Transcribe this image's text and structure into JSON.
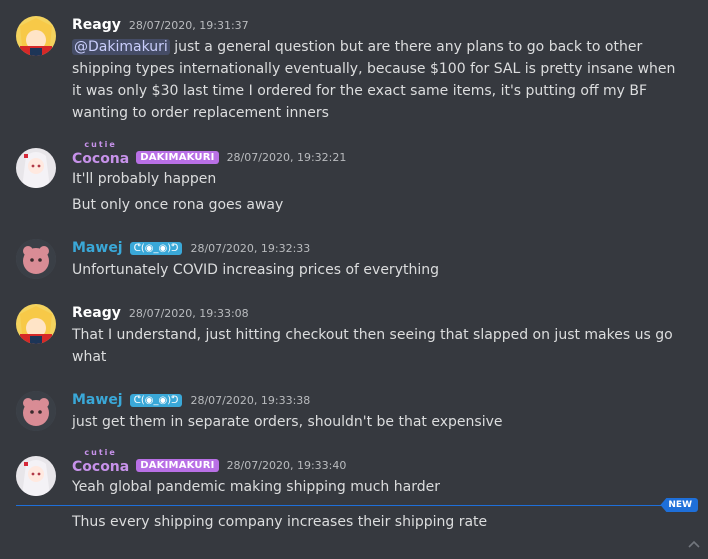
{
  "colors": {
    "background": "#36393f",
    "reagy": "#ffffff",
    "cocona": "#c792ea",
    "mawej": "#3aa8d8",
    "role_dakimakuri": "#b970e6",
    "new_line": "#1e6fd9"
  },
  "messages": [
    {
      "author": "Reagy",
      "timestamp": "28/07/2020, 19:31:37",
      "mention": "@Dakimakuri",
      "text": " just a general question but are there any plans to go back to other shipping types internationally eventually, because $100 for SAL is pretty insane when it was only $30 last time I ordered for the exact same items, it's putting off my BF wanting to order replacement inners"
    },
    {
      "author": "Cocona",
      "author_superscript": "cutie",
      "role": "DAKIMAKURI",
      "timestamp": "28/07/2020, 19:32:21",
      "lines": [
        "It'll probably happen",
        "But only once rona goes away"
      ]
    },
    {
      "author": "Mawej",
      "emote": "ᕦ(◉_◉)ᕤ",
      "timestamp": "28/07/2020, 19:32:33",
      "text": "Unfortunately COVID increasing prices of everything"
    },
    {
      "author": "Reagy",
      "timestamp": "28/07/2020, 19:33:08",
      "text": "That I understand, just hitting checkout then seeing that slapped on just makes us go what"
    },
    {
      "author": "Mawej",
      "emote": "ᕦ(◉_◉)ᕤ",
      "timestamp": "28/07/2020, 19:33:38",
      "text": "just get them in separate orders, shouldn't be that expensive"
    },
    {
      "author": "Cocona",
      "author_superscript": "cutie",
      "role": "DAKIMAKURI",
      "timestamp": "28/07/2020, 19:33:40",
      "text": "Yeah global pandemic making shipping much harder"
    }
  ],
  "new_divider": {
    "label": "NEW"
  },
  "after_new": {
    "text": "Thus every shipping company increases their shipping rate"
  },
  "icons": {
    "scroll": "chevron-up-icon"
  }
}
